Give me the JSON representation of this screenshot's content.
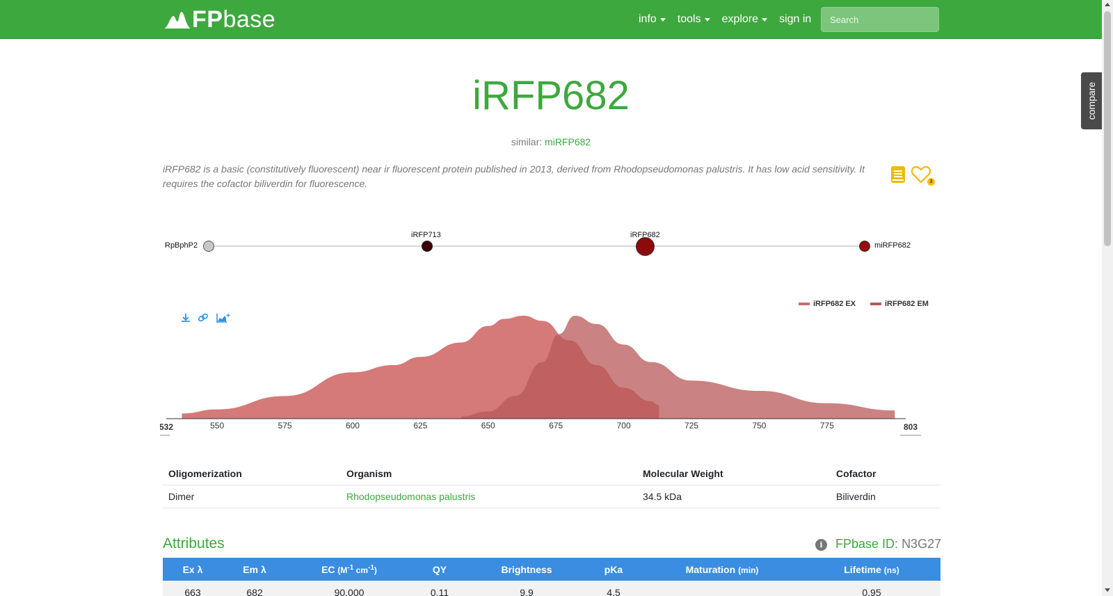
{
  "nav": {
    "brand_bold": "FP",
    "brand_light": "base",
    "items": [
      "info",
      "tools",
      "explore",
      "sign in"
    ],
    "search_placeholder": "Search",
    "color": "#3da83d"
  },
  "compare_tab": "compare",
  "protein": {
    "name": "iRFP682",
    "similar_label": "similar:",
    "similar_link": "miRFP682",
    "description": "iRFP682 is a basic (constitutively fluorescent) near ir fluorescent protein published in 2013, derived from Rhodopseudomonas palustris. It has low acid sensitivity. It requires the cofactor biliverdin for fluorescence.",
    "favorite_count": "3"
  },
  "lineage": {
    "nodes": [
      {
        "label": "RpBphP2",
        "color": "#c8c8c8"
      },
      {
        "label": "iRFP713",
        "color": "#3a0008"
      },
      {
        "label": "iRFP682",
        "color": "#8b0a0a"
      },
      {
        "label": "miRFP682",
        "color": "#9a0a0a"
      }
    ]
  },
  "chart_data": {
    "type": "area",
    "x_ticks": [
      550,
      575,
      600,
      625,
      650,
      675,
      700,
      725,
      750,
      775
    ],
    "x_min_label": "532",
    "x_max_label": "803",
    "xlim": [
      532,
      803
    ],
    "series": [
      {
        "name": "iRFP682 EX",
        "color": "#d06a6a",
        "x": [
          537,
          550,
          575,
          600,
          615,
          625,
          640,
          650,
          656,
          663,
          670,
          680,
          690,
          700,
          710,
          713
        ],
        "y": [
          0.05,
          0.09,
          0.22,
          0.45,
          0.52,
          0.6,
          0.74,
          0.9,
          0.97,
          1.0,
          0.95,
          0.76,
          0.52,
          0.3,
          0.17,
          0.13
        ]
      },
      {
        "name": "iRFP682 EM",
        "color": "#b85858",
        "x": [
          640,
          650,
          660,
          670,
          676,
          682,
          690,
          700,
          710,
          725,
          750,
          775,
          800
        ],
        "y": [
          0.02,
          0.07,
          0.22,
          0.55,
          0.82,
          1.0,
          0.92,
          0.72,
          0.55,
          0.37,
          0.27,
          0.15,
          0.08
        ]
      }
    ]
  },
  "legend": [
    "iRFP682 EX",
    "iRFP682 EM"
  ],
  "info_table": {
    "headers": [
      "Oligomerization",
      "Organism",
      "Molecular Weight",
      "Cofactor"
    ],
    "row": [
      "Dimer",
      "Rhodopseudomonas palustris",
      "34.5 kDa",
      "Biliverdin"
    ]
  },
  "attributes": {
    "title": "Attributes",
    "fpbase_id_label": "FPbase ID:",
    "fpbase_id": "N3G27",
    "headers": [
      "Ex λ",
      "Em λ",
      "EC",
      "QY",
      "Brightness",
      "pKa",
      "Maturation",
      "Lifetime"
    ],
    "ec_unit": "(M-1 cm-1)",
    "maturation_unit": "(min)",
    "lifetime_unit": "(ns)",
    "values": [
      "663",
      "682",
      "90,000",
      "0.11",
      "9.9",
      "4.5",
      "",
      "0.95"
    ],
    "header_color": "#3a8de0"
  }
}
